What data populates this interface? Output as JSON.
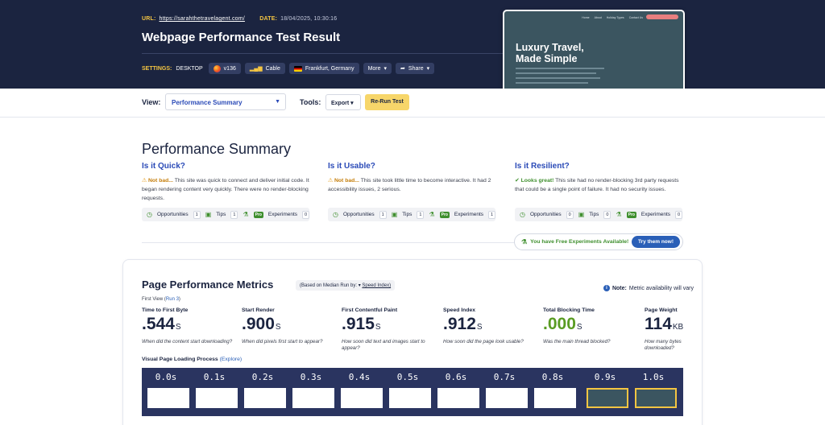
{
  "header": {
    "url_label": "URL:",
    "url": "https://sarahthetravelagent.com/",
    "date_label": "DATE:",
    "date": "18/04/2025, 10:30:16",
    "title": "Webpage Performance Test Result",
    "settings_label": "SETTINGS:",
    "settings_device": "DESKTOP",
    "browser": "v136",
    "connection": "Cable",
    "location": "Frankfurt, Germany",
    "more": "More",
    "share": "Share"
  },
  "preview": {
    "nav": [
      "Home",
      "About",
      "Holiday Types",
      "Contact Us"
    ],
    "heading_line1": "Luxury Travel,",
    "heading_line2": "Made Simple"
  },
  "toolbar": {
    "view_label": "View:",
    "view_value": "Performance Summary",
    "tools_label": "Tools:",
    "export": "Export",
    "rerun": "Re-Run Test"
  },
  "summary": {
    "title": "Performance Summary",
    "columns": [
      {
        "heading": "Is it Quick?",
        "verdict": "Not bad...",
        "text": "This site was quick to connect and deliver initial code. It began rendering content very quickly. There were no render-blocking requests.",
        "opportunities": "1",
        "tips": "1",
        "experiments": "0"
      },
      {
        "heading": "Is it Usable?",
        "verdict": "Not bad...",
        "text": "This site took little time to become interactive. It had 2 accessibility issues, 2 serious.",
        "opportunities": "1",
        "tips": "1",
        "experiments": "1"
      },
      {
        "heading": "Is it Resilient?",
        "verdict": "Looks great!",
        "text": "This site had no render-blocking 3rd party requests that could be a single point of failure. It had no security issues.",
        "opportunities": "0",
        "tips": "0",
        "experiments": "0"
      }
    ],
    "labels": {
      "opportunities": "Opportunities",
      "tips": "Tips",
      "pro": "Pro",
      "experiments": "Experiments"
    },
    "free_experiments": "You have Free Experiments Available!",
    "try_them": "Try them now!"
  },
  "metrics": {
    "title": "Page Performance Metrics",
    "based_on": "(Based on Median Run by:",
    "based_metric": "Speed Index)",
    "note_label": "Note:",
    "note_text": "Metric availability will vary",
    "first_view": "First View (",
    "run": "Run 3",
    "first_view_end": ")",
    "items": [
      {
        "label": "Time to First Byte",
        "value": ".544",
        "unit": "S",
        "desc": "When did the content start downloading?"
      },
      {
        "label": "Start Render",
        "value": ".900",
        "unit": "S",
        "desc": "When did pixels first start to appear?"
      },
      {
        "label": "First Contentful Paint",
        "value": ".915",
        "unit": "S",
        "desc": "How soon did text and images start to appear?"
      },
      {
        "label": "Speed Index",
        "value": ".912",
        "unit": "S",
        "desc": "How soon did the page look usable?"
      },
      {
        "label": "Total Blocking Time",
        "value": ".000",
        "unit": "S",
        "desc": "Was the main thread blocked?"
      },
      {
        "label": "Page Weight",
        "value": "114",
        "unit": "KB",
        "desc": "How many bytes downloaded?"
      }
    ],
    "visual_label": "Visual Page Loading Process",
    "explore": "(Explore)",
    "frames": [
      "0.0s",
      "0.1s",
      "0.2s",
      "0.3s",
      "0.4s",
      "0.5s",
      "0.6s",
      "0.7s",
      "0.8s",
      "0.9s",
      "1.0s"
    ]
  },
  "colors": {
    "header_bg": "#1b2440",
    "accent_blue": "#2a4ab7",
    "good_green": "#3f8f2e",
    "warn_orange": "#c47d0a",
    "rerun_yellow": "#f7d66a"
  }
}
